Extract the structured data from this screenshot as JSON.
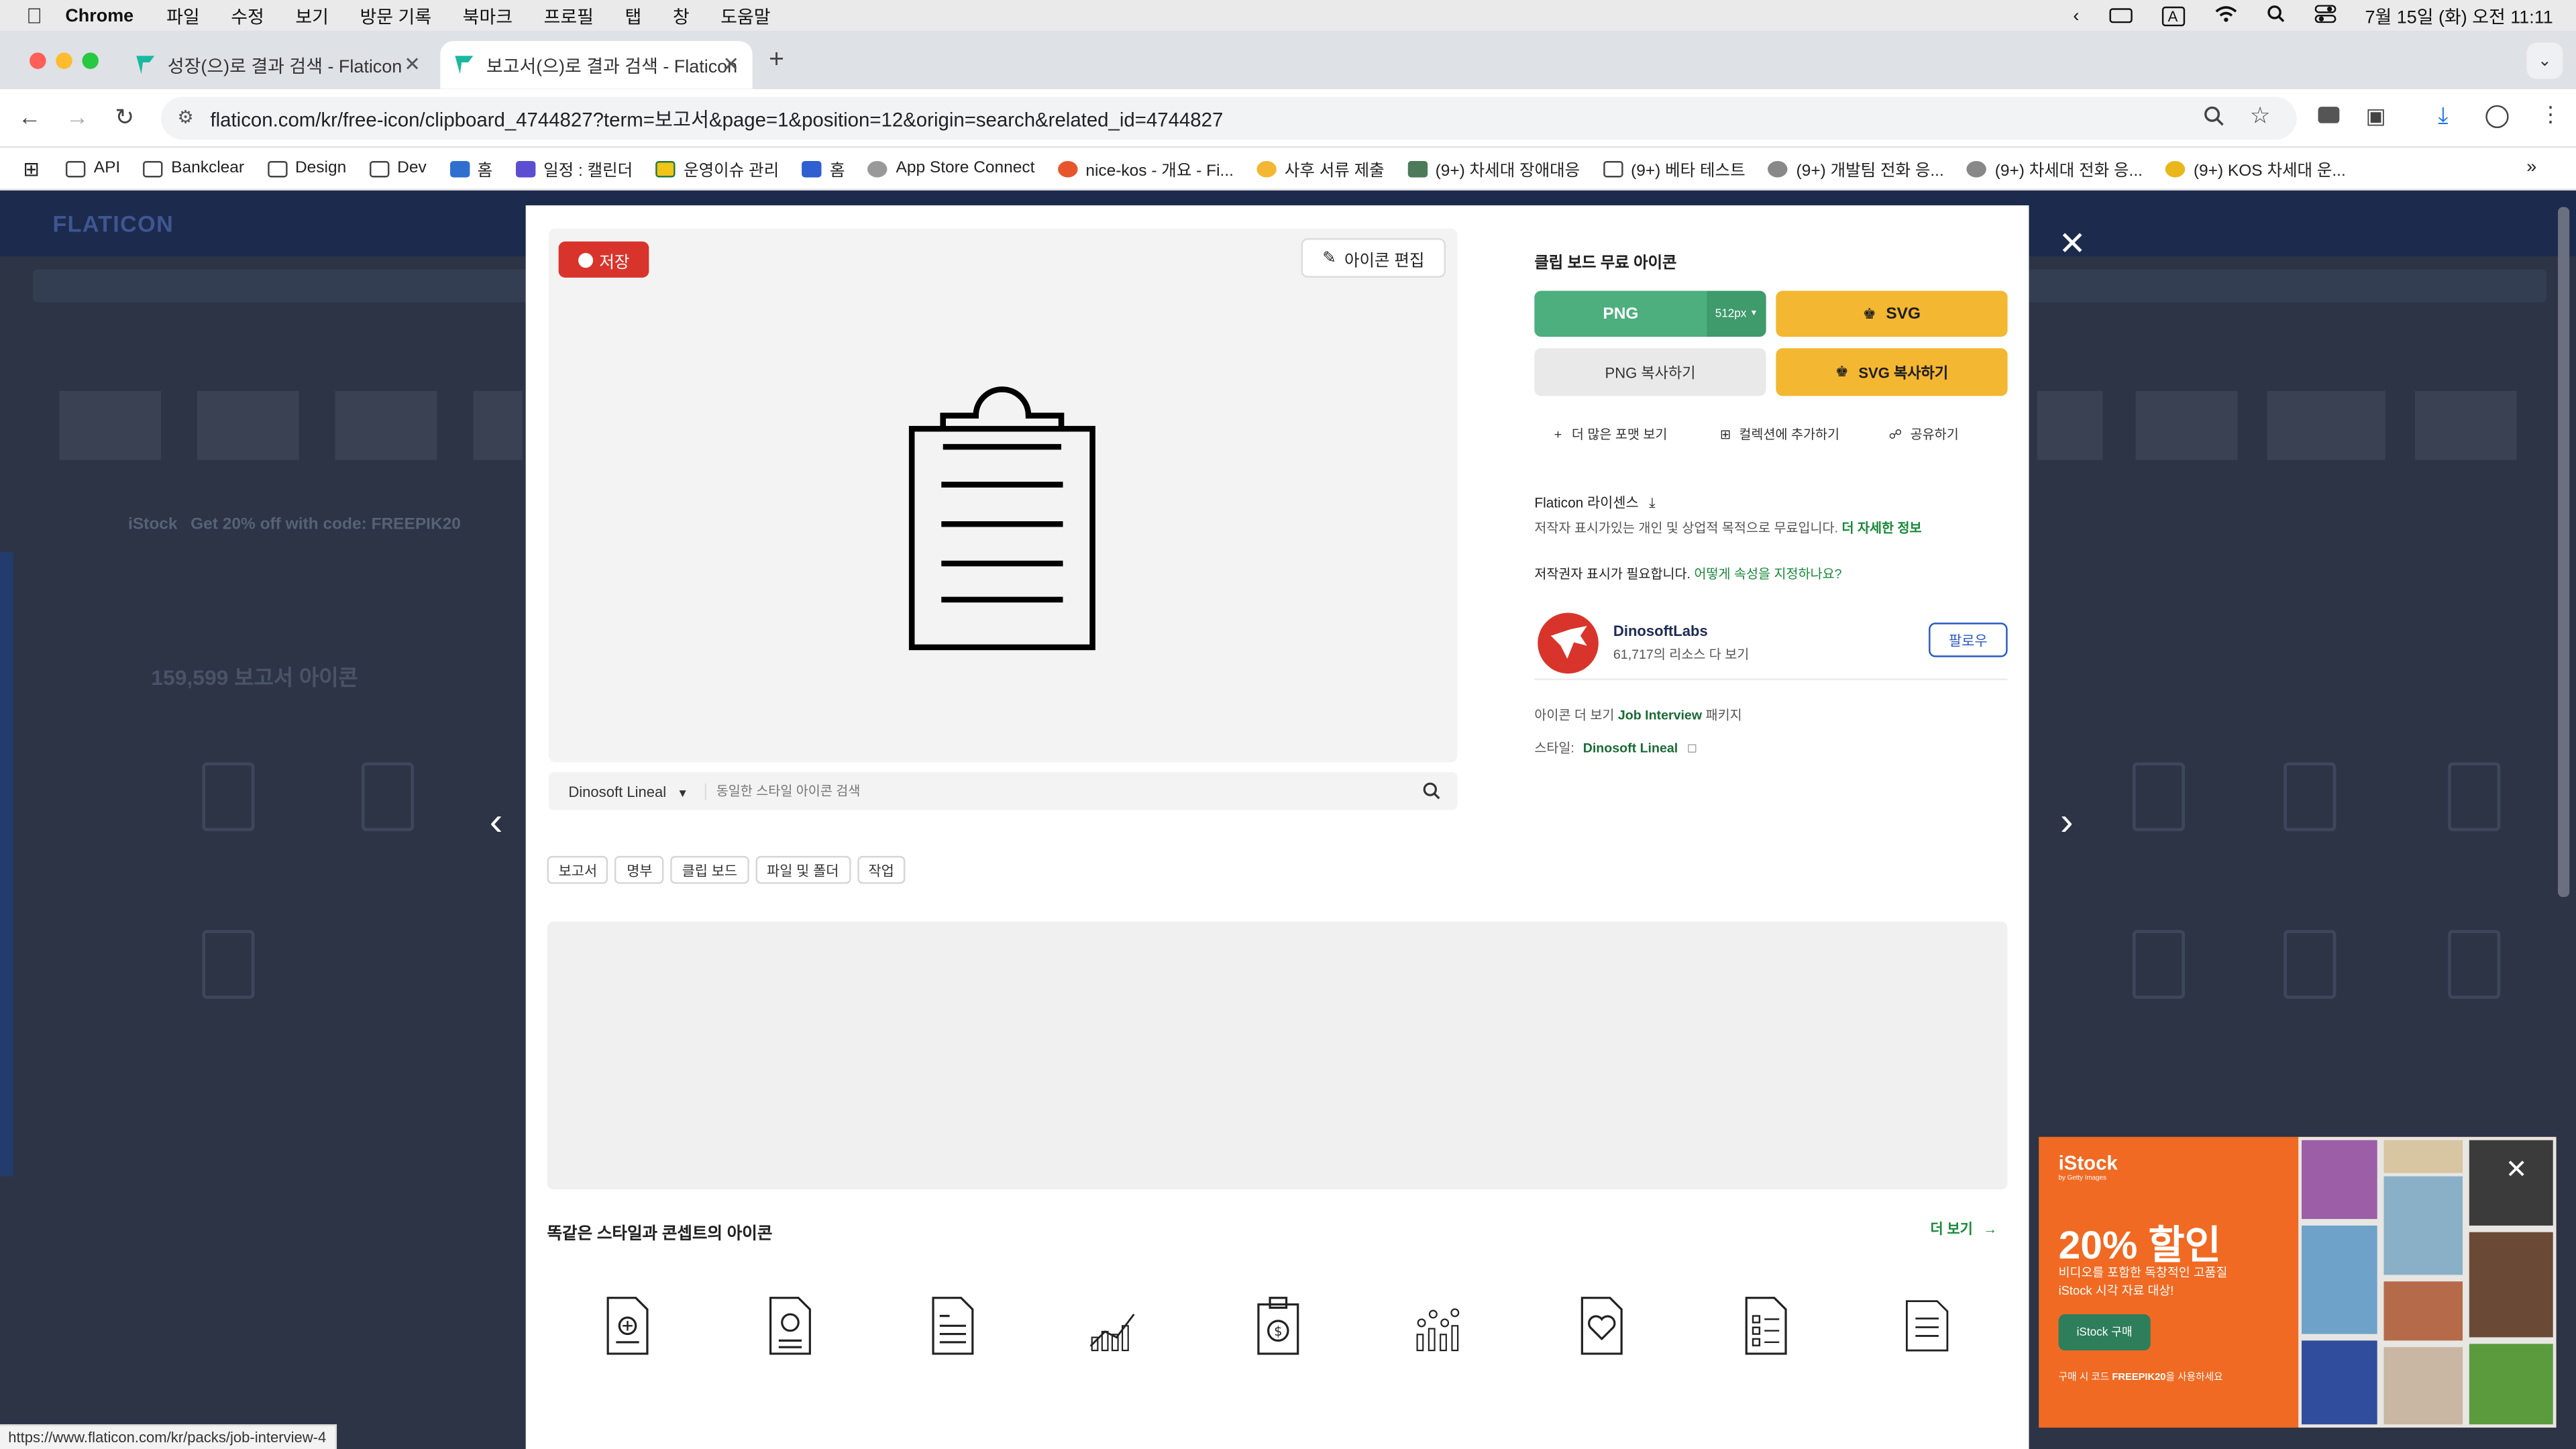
{
  "menubar": {
    "app": "Chrome",
    "items": [
      "파일",
      "수정",
      "보기",
      "방문 기록",
      "북마크",
      "프로필",
      "탭",
      "창",
      "도움말"
    ],
    "clock": "7월 15일 (화) 오전 11:11",
    "input_mode": "A"
  },
  "tabs": [
    {
      "title": "성장(으)로 결과 검색 - Flaticon"
    },
    {
      "title": "보고서(으)로 결과 검색 - Flaticon"
    }
  ],
  "omnibox": {
    "url": "flaticon.com/kr/free-icon/clipboard_4744827?term=보고서&page=1&position=12&origin=search&related_id=4744827"
  },
  "bookmarks": [
    "API",
    "Bankclear",
    "Design",
    "Dev",
    "홈",
    "일정 : 캘린더",
    "운영이슈 관리",
    "홈",
    "App Store Connect",
    "nice-kos - 개요 - Fi...",
    "사후 서류 제출",
    "(9+) 차세대 장애대응",
    "(9+) 베타 테스트",
    "(9+) 개발팀 전화 응...",
    "(9+) 차세대 전화 응...",
    "(9+) KOS 차세대 운..."
  ],
  "modal": {
    "save_label": "저장",
    "edit_label": "아이콘 편집",
    "style_select": "Dinosoft Lineal",
    "style_search_placeholder": "동일한 스타일 아이콘 검색",
    "tags": [
      "보고서",
      "명부",
      "클립 보드",
      "파일 및 폴더",
      "작업"
    ],
    "title": "클립 보드 무료 아이콘",
    "png_label": "PNG",
    "png_size": "512px",
    "svg_label": "SVG",
    "png_copy_label": "PNG 복사하기",
    "svg_copy_label": "SVG 복사하기",
    "more_formats": "더 많은 포맷 보기",
    "add_collection": "컬렉션에 추가하기",
    "share": "공유하기",
    "license_title": "Flaticon 라이센스",
    "license_text": "저작자 표시가있는 개인 및 상업적 목적으로 무료입니다.",
    "license_more": "더 자세한 정보",
    "attribution_text": "저작권자 표시가 필요합니다.",
    "attribution_link": "어떻게 속성을 지정하나요?",
    "author_name": "DinosoftLabs",
    "author_resources": "61,717의 리소스 다 보기",
    "follow_label": "팔로우",
    "more_icons_prefix": "아이콘 더 보기",
    "more_icons_pack": "Job Interview",
    "more_icons_suffix": "패키지",
    "style_prefix": "스타일:",
    "style_name": "Dinosoft Lineal",
    "similar_title": "똑같은 스타일과 콘셉트의 아이콘",
    "see_more": "더 보기"
  },
  "istock": {
    "brand": "iStock",
    "brand_sub": "by Getty Images",
    "headline": "20% 할인",
    "line1": "비디오를 포함한 독창적인 고품질",
    "line2": "iStock 시각 자료 대상!",
    "cta": "iStock 구매",
    "code_prefix": "구매 시 코드",
    "code": "FREEPIK20",
    "code_suffix": "을 사용하세요"
  },
  "background": {
    "logo": "FLATICON",
    "result_count": "159,599 보고서 아이콘",
    "promo": "Get 20% off with code: FREEPIK20"
  },
  "status_url": "https://www.flaticon.com/kr/packs/job-interview-4",
  "colors": {
    "green": "#4caf7d",
    "yellow": "#f4b731",
    "red_save": "#d9342b"
  }
}
